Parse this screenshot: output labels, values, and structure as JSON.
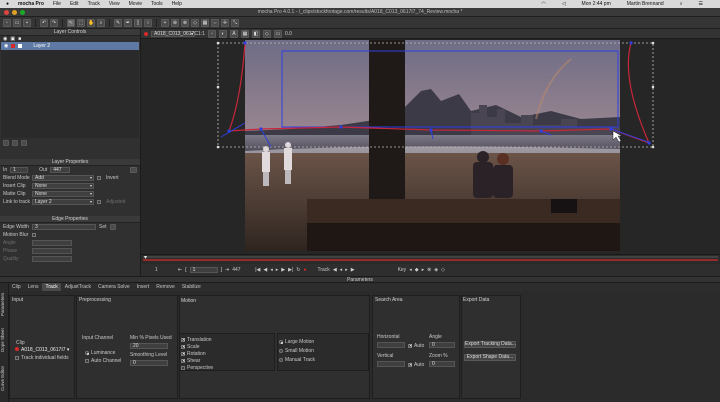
{
  "menubar": {
    "app_name": "mocha Pro",
    "items": [
      "File",
      "Edit",
      "Track",
      "View",
      "Movie",
      "Tools",
      "Help"
    ],
    "day_time": "Mon 2:44 pm",
    "user": "Martin Brennand"
  },
  "window": {
    "title": "mocha Pro 4.0.1 - /_clips/stockfootage.com/results/A018_C013_0617I7_74_Review.mocha *"
  },
  "toolbar": {
    "zoom_value": "1.1"
  },
  "layer_controls": {
    "header": "Layer Controls",
    "layers": [
      {
        "name": "Layer 2"
      }
    ]
  },
  "layer_properties": {
    "header": "Layer Properties",
    "in_label": "In",
    "in_value": "1",
    "out_label": "Out",
    "out_value": "447",
    "blend_mode_label": "Blend Mode",
    "blend_mode_value": "Add",
    "invert_label": "Invert",
    "insert_clip_label": "Insert Clip",
    "insert_clip_value": "None",
    "matte_clip_label": "Matte Clip",
    "matte_clip_value": "None",
    "link_label": "Link to track",
    "link_value": "Layer 2",
    "adjusted_label": "Adjusted"
  },
  "edge_properties": {
    "header": "Edge Properties",
    "edge_width_label": "Edge Width",
    "edge_width_value": "3",
    "set_label": "Set",
    "motion_blur_label": "Motion Blur",
    "angle_label": "Angle",
    "phase_label": "Phase",
    "quality_label": "Quality"
  },
  "viewer": {
    "clip_name": "A018_C013_0617C",
    "zoom": "1:1",
    "exposure": "0.0"
  },
  "timeline": {
    "start_frame": "1",
    "current_frame": "1",
    "end_frame": "447",
    "track_label": "Track",
    "key_label": "Key"
  },
  "parameters": {
    "title": "Parameters",
    "side_tabs": [
      "Parameters",
      "Dope Sheet",
      "Curve Editor"
    ],
    "tabs": [
      "Clip",
      "Lens",
      "Track",
      "AdjustTrack",
      "Camera Solve",
      "Insert",
      "Remove",
      "Stabilize"
    ],
    "selected_tab": "Track",
    "input": {
      "header": "Input",
      "clip_label": "Clip",
      "clip_value": "A018_C013_0617I7",
      "track_individual": "Track individual fields"
    },
    "preprocessing": {
      "header": "Preprocessing",
      "input_channel_label": "Input Channel",
      "luminance": "Luminance",
      "auto_channel": "Auto Channel",
      "min_pixels_label": "Min % Pixels Used",
      "min_pixels_value": "20",
      "smoothing_label": "Smoothing Level",
      "smoothing_value": "0"
    },
    "motion": {
      "header": "Motion",
      "translation": "Translation",
      "scale": "Scale",
      "rotation": "Rotation",
      "shear": "Shear",
      "perspective": "Perspective",
      "large_motion": "Large Motion",
      "small_motion": "Small Motion",
      "manual_track": "Manual Track"
    },
    "search_area": {
      "header": "Search Area",
      "horizontal_label": "Horizontal",
      "vertical_label": "Vertical",
      "auto_label": "Auto",
      "angle_label": "Angle",
      "angle_value": "0",
      "zoom_label": "Zoom %",
      "zoom_value": "0"
    },
    "export_data": {
      "header": "Export Data",
      "export_tracking": "Export Tracking Data...",
      "export_shape": "Export Shape Data..."
    }
  },
  "colors": {
    "accent_red": "#d42a2a",
    "track_blue": "#2f3fe0",
    "spline_red": "#c8263a",
    "layer_selected": "#5e79a4"
  }
}
